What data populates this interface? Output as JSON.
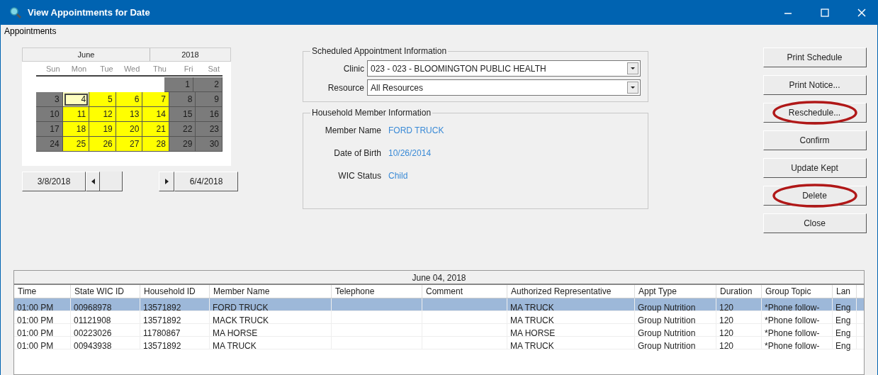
{
  "window": {
    "title": "View Appointments for Date"
  },
  "menu": [
    "Appointments"
  ],
  "calendar": {
    "month": "June",
    "year": "2018",
    "weekdays": [
      "Sun",
      "Mon",
      "Tue",
      "Wed",
      "Thu",
      "Fri",
      "Sat"
    ],
    "weeks": [
      [
        {
          "kind": "empty"
        },
        {
          "kind": "empty"
        },
        {
          "kind": "empty"
        },
        {
          "kind": "empty"
        },
        {
          "kind": "empty"
        },
        {
          "kind": "closed",
          "day": "1",
          "selected": false
        },
        {
          "kind": "closed",
          "day": "2",
          "selected": false
        }
      ],
      [
        {
          "kind": "closed",
          "day": "3",
          "selected": false
        },
        {
          "kind": "open",
          "day": "4",
          "selected": true
        },
        {
          "kind": "open",
          "day": "5",
          "selected": false
        },
        {
          "kind": "open",
          "day": "6",
          "selected": false
        },
        {
          "kind": "open",
          "day": "7",
          "selected": false
        },
        {
          "kind": "closed",
          "day": "8",
          "selected": false
        },
        {
          "kind": "closed",
          "day": "9",
          "selected": false
        }
      ],
      [
        {
          "kind": "closed",
          "day": "10",
          "selected": false
        },
        {
          "kind": "open",
          "day": "11",
          "selected": false
        },
        {
          "kind": "open",
          "day": "12",
          "selected": false
        },
        {
          "kind": "open",
          "day": "13",
          "selected": false
        },
        {
          "kind": "open",
          "day": "14",
          "selected": false
        },
        {
          "kind": "closed",
          "day": "15",
          "selected": false
        },
        {
          "kind": "closed",
          "day": "16",
          "selected": false
        }
      ],
      [
        {
          "kind": "closed",
          "day": "17",
          "selected": false
        },
        {
          "kind": "open",
          "day": "18",
          "selected": false
        },
        {
          "kind": "open",
          "day": "19",
          "selected": false
        },
        {
          "kind": "open",
          "day": "20",
          "selected": false
        },
        {
          "kind": "open",
          "day": "21",
          "selected": false
        },
        {
          "kind": "closed",
          "day": "22",
          "selected": false
        },
        {
          "kind": "closed",
          "day": "23",
          "selected": false
        }
      ],
      [
        {
          "kind": "closed",
          "day": "24",
          "selected": false
        },
        {
          "kind": "open",
          "day": "25",
          "selected": false
        },
        {
          "kind": "open",
          "day": "26",
          "selected": false
        },
        {
          "kind": "open",
          "day": "27",
          "selected": false
        },
        {
          "kind": "open",
          "day": "28",
          "selected": false
        },
        {
          "kind": "closed",
          "day": "29",
          "selected": false
        },
        {
          "kind": "closed",
          "day": "30",
          "selected": false
        }
      ]
    ],
    "prev_date": "3/8/2018",
    "next_date": "6/4/2018"
  },
  "scheduled": {
    "title": "Scheduled Appointment Information",
    "fields": [
      {
        "label": "Clinic",
        "value": "023 - 023 - BLOOMINGTON PUBLIC HEALTH"
      },
      {
        "label": "Resource",
        "value": "All Resources"
      }
    ]
  },
  "household": {
    "title": "Household Member Information",
    "fields": [
      {
        "label": "Member Name",
        "value": "FORD TRUCK"
      },
      {
        "label": "Date of Birth",
        "value": "10/26/2014"
      },
      {
        "label": "WIC Status",
        "value": "Child"
      }
    ]
  },
  "buttons": [
    {
      "label": "Print Schedule",
      "circled": false
    },
    {
      "label": "Print Notice...",
      "circled": false
    },
    {
      "label": "Reschedule...",
      "circled": true
    },
    {
      "label": "Confirm",
      "circled": false
    },
    {
      "label": "Update Kept",
      "circled": false
    },
    {
      "label": "Delete",
      "circled": true
    },
    {
      "label": "Close",
      "circled": false
    }
  ],
  "table": {
    "title": "June 04, 2018",
    "columns": [
      "Time",
      "State WIC ID",
      "Household ID",
      "Member Name",
      "Telephone",
      "Comment",
      "Authorized Representative",
      "Appt Type",
      "Duration",
      "Group Topic",
      "Lan"
    ],
    "rows": [
      {
        "selected": true,
        "cells": [
          "01:00 PM",
          "00968978",
          "13571892",
          "FORD TRUCK",
          "",
          "",
          "MA TRUCK",
          "Group Nutrition",
          "120",
          "*Phone follow-",
          "Eng"
        ]
      },
      {
        "selected": false,
        "cells": [
          "01:00 PM",
          "01121908",
          "13571892",
          "MACK TRUCK",
          "",
          "",
          "MA TRUCK",
          "Group Nutrition",
          "120",
          "*Phone follow-",
          "Eng"
        ]
      },
      {
        "selected": false,
        "cells": [
          "01:00 PM",
          "00223026",
          "11780867",
          "MA HORSE",
          "",
          "",
          "MA HORSE",
          "Group Nutrition",
          "120",
          "*Phone follow-",
          "Eng"
        ]
      },
      {
        "selected": false,
        "cells": [
          "01:00 PM",
          "00943938",
          "13571892",
          "MA TRUCK",
          "",
          "",
          "MA TRUCK",
          "Group Nutrition",
          "120",
          "*Phone follow-",
          "Eng"
        ]
      }
    ]
  }
}
